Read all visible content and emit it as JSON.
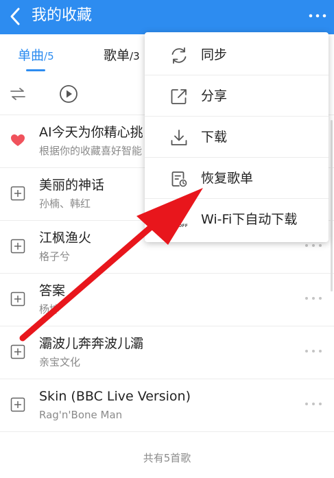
{
  "header": {
    "title": "我的收藏"
  },
  "tabs": [
    {
      "label": "单曲",
      "count": "/5"
    },
    {
      "label": "歌单",
      "count": "/3"
    }
  ],
  "songs": [
    {
      "name": "AI今天为你精心挑",
      "artist": "根据你的收藏喜好智能"
    },
    {
      "name": "美丽的神话",
      "artist": "孙楠、韩红"
    },
    {
      "name": "江枫渔火",
      "artist": "格子兮"
    },
    {
      "name": "答案",
      "artist": "杨坤"
    },
    {
      "name": "灞波儿奔奔波儿灞",
      "artist": "亲宝文化"
    },
    {
      "name": "Skin (BBC Live Version)",
      "artist": "Rag'n'Bone Man"
    }
  ],
  "footer": {
    "text": "共有5首歌"
  },
  "menu": {
    "items": [
      {
        "label": "同步",
        "icon": "sync-icon"
      },
      {
        "label": "分享",
        "icon": "share-icon"
      },
      {
        "label": "下载",
        "icon": "download-icon"
      },
      {
        "label": "恢复歌单",
        "icon": "restore-playlist-icon"
      },
      {
        "label": "Wi-Fi下自动下载",
        "icon": "wifi-auto-download-icon",
        "badge": "OFF"
      }
    ]
  },
  "colors": {
    "accent": "#2d8cf0",
    "heart": "#f0525c",
    "arrow": "#e8161c"
  }
}
